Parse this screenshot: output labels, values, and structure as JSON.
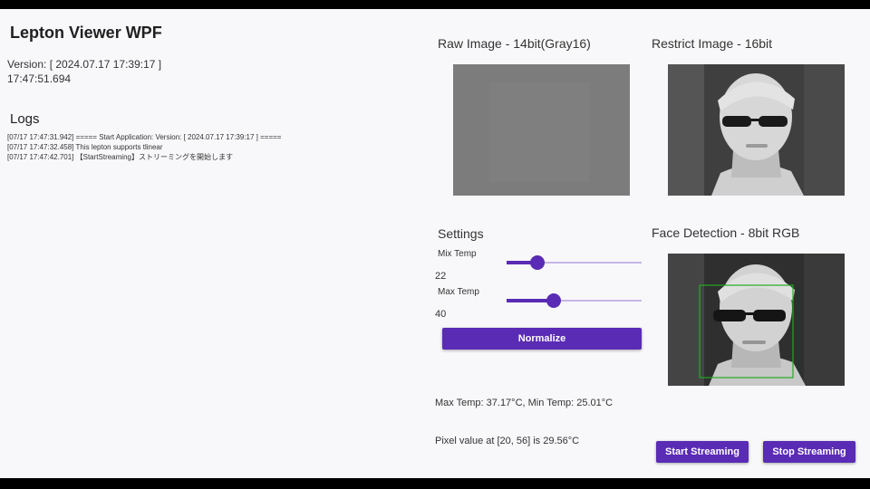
{
  "app": {
    "title": "Lepton Viewer WPF",
    "version_line": "Version: [ 2024.07.17 17:39:17 ]",
    "clock": "17:47:51.694"
  },
  "logs": {
    "title": "Logs",
    "entries": [
      "[07/17 17:47:31.942] ===== Start Application: Version: [ 2024.07.17 17:39:17 ] =====",
      "[07/17 17:47:32.458] This lepton supports tlinear",
      "[07/17 17:47:42.701] 【StartStreaming】ストリーミングを開始します"
    ]
  },
  "raw_image": {
    "title": "Raw Image - 14bit(Gray16)"
  },
  "restrict_image": {
    "title": "Restrict Image - 16bit"
  },
  "face_detection": {
    "title": "Face Detection - 8bit RGB"
  },
  "settings": {
    "title": "Settings",
    "min_temp": {
      "label": "Mix Temp",
      "value": "22",
      "fraction": 0.23
    },
    "max_temp": {
      "label": "Max Temp",
      "value": "40",
      "fraction": 0.35
    },
    "normalize_label": "Normalize"
  },
  "status": {
    "temp_range": "Max Temp: 37.17°C, Min Temp: 25.01°C",
    "pixel_value": "Pixel value at [20, 56] is 29.56°C"
  },
  "buttons": {
    "start_label": "Start Streaming",
    "stop_label": "Stop Streaming"
  },
  "colors": {
    "accent": "#5a2bb5",
    "track": "#c6b6e6",
    "detection_box": "#22aa22"
  }
}
